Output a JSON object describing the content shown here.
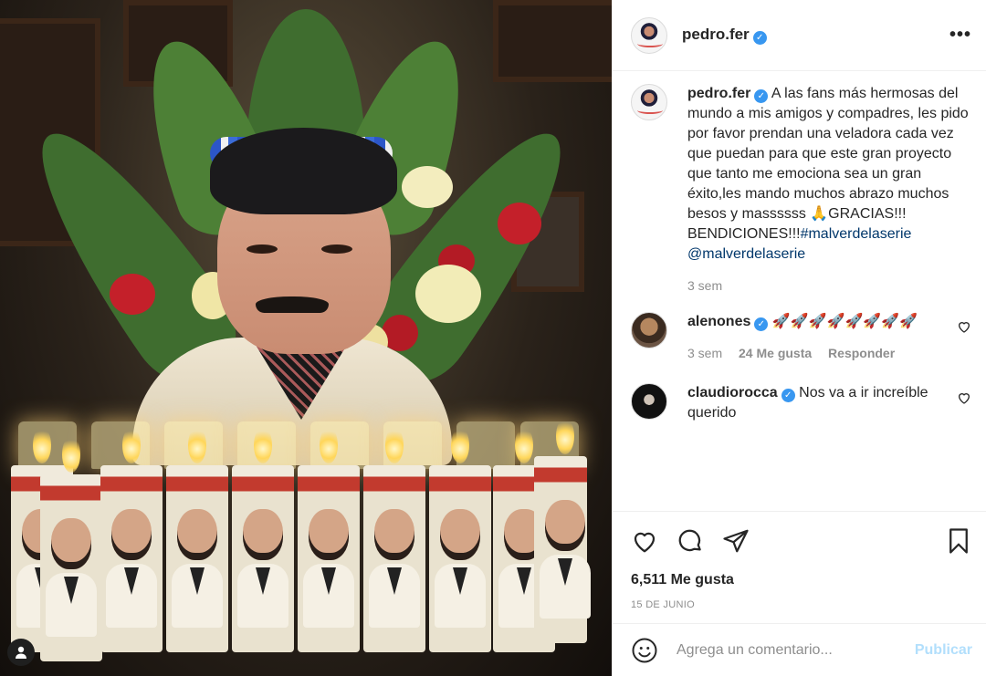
{
  "post": {
    "author": "pedro.fer",
    "caption_text": "A las fans más hermosas del mundo a mis amigos y compadres, les pido por favor prendan una veladora cada vez que puedan para que este gran proyecto que tanto me emociona sea un gran éxito,les mando muchos abrazo muchos besos y massssss 🙏GRACIAS!!! BENDICIONES!!!",
    "hashtag": "#malverdelaserie",
    "mention": "@malverdelaserie",
    "caption_age": "3 sem",
    "likes": "6,511 Me gusta",
    "date": "15 DE JUNIO"
  },
  "comments": [
    {
      "user": "alenones",
      "text": "🚀🚀🚀🚀🚀🚀🚀🚀",
      "age": "3 sem",
      "likes": "24 Me gusta",
      "reply": "Responder"
    },
    {
      "user": "claudiorocca",
      "text": "Nos va a ir increíble querido"
    }
  ],
  "composer": {
    "placeholder": "Agrega un comentario...",
    "publish": "Publicar"
  },
  "icons": {
    "more": "more-options-icon",
    "like": "heart-icon",
    "comment": "comment-icon",
    "share": "share-icon",
    "save": "bookmark-icon",
    "emoji": "emoji-icon",
    "user": "user-tag-icon"
  },
  "colors": {
    "verified": "#3897f0",
    "link": "#00376b",
    "publish_disabled": "#b2dffc",
    "meta": "#8e8e8e"
  }
}
